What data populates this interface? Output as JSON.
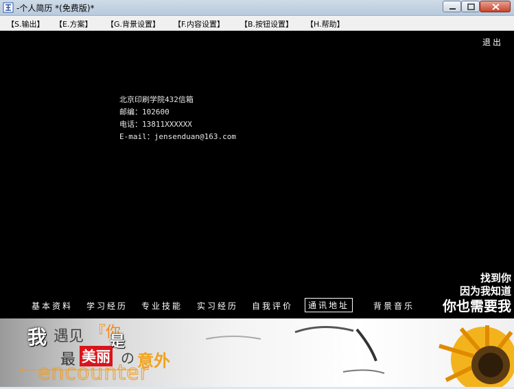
{
  "window": {
    "title": "-个人简历 *(免费版)*"
  },
  "menu": [
    {
      "label": "【S.输出】"
    },
    {
      "label": "【E.方案】"
    },
    {
      "label": "【G.背景设置】"
    },
    {
      "label": "【F.内容设置】"
    },
    {
      "label": "【B.按钮设置】"
    },
    {
      "label": "【H.帮助】"
    }
  ],
  "exit_label": "退出",
  "contact": {
    "address": "北京印刷学院432信箱",
    "postcode": "邮编：102600",
    "phone": "电话：13811XXXXXX",
    "email": "E-mail：jensenduan@163.com"
  },
  "nav": [
    {
      "label": "基本资料"
    },
    {
      "label": "学习经历"
    },
    {
      "label": "专业技能"
    },
    {
      "label": "实习经历"
    },
    {
      "label": "自我评价"
    },
    {
      "label": "通讯地址",
      "active": true
    },
    {
      "label": "背景音乐"
    }
  ],
  "slogan": {
    "line1": "找到你",
    "line2": "因为我知道",
    "line3": "你也需要我"
  },
  "banner": {
    "wo": "我",
    "yujian": "遇见",
    "ni": "『你",
    "shi": "是",
    "zui": "最",
    "meili": "美丽",
    "no": "の",
    "yiwai": "意外",
    "encounter": "encounter"
  },
  "colors": {
    "content_bg": "#000000",
    "active_border": "#ffffff",
    "accent_orange": "#f2a21b",
    "accent_red": "#d8151b"
  }
}
